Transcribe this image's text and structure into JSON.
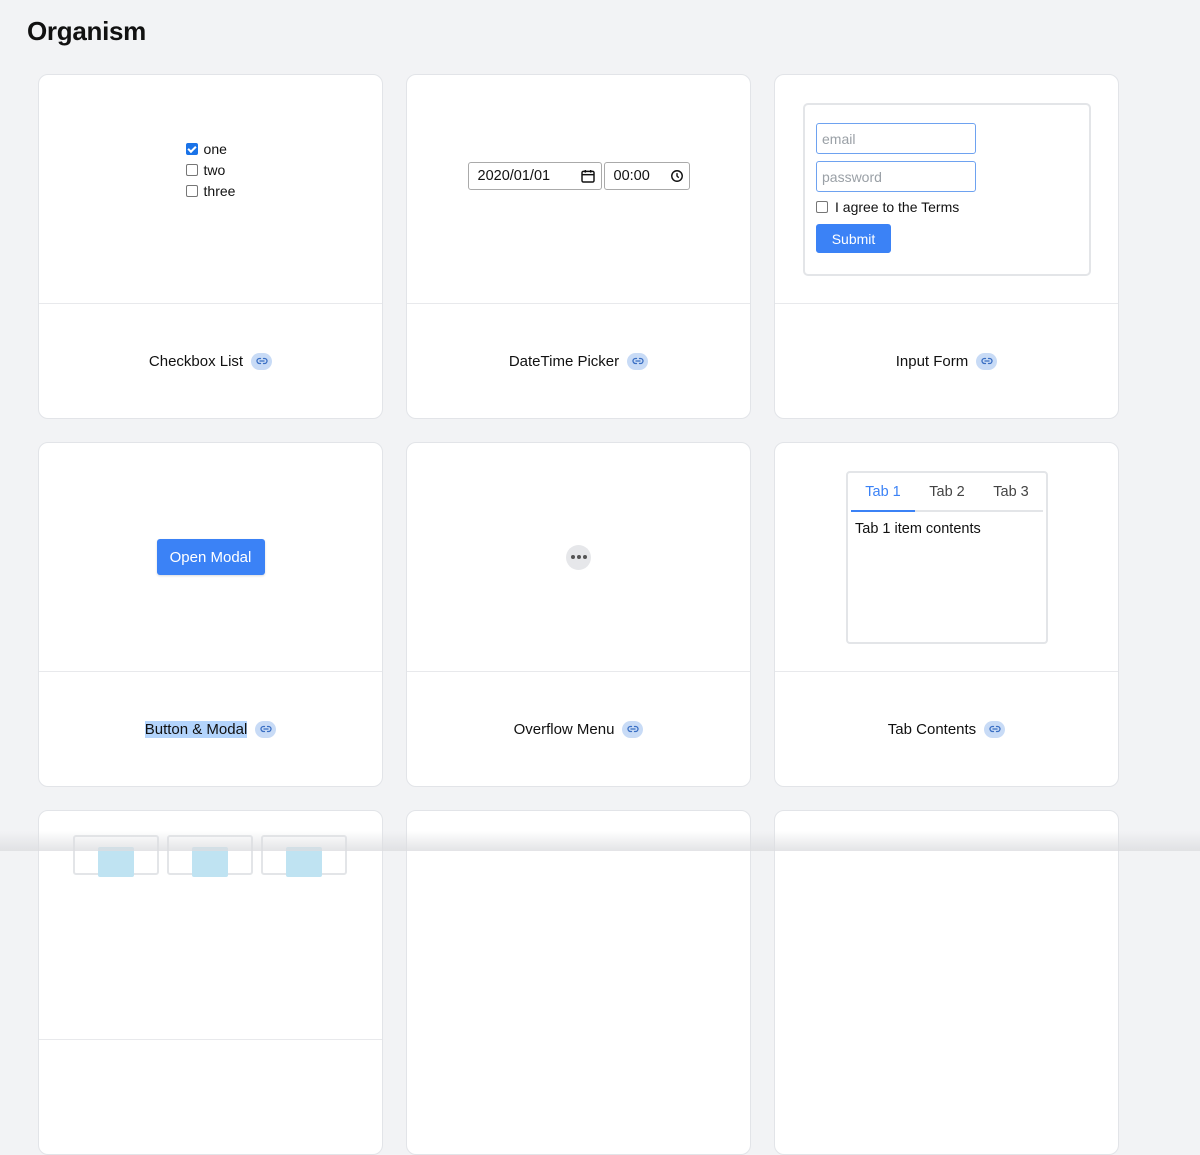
{
  "page": {
    "title": "Organism"
  },
  "cards": {
    "checkbox_list": {
      "label": "Checkbox List",
      "items": [
        {
          "label": "one",
          "checked": true
        },
        {
          "label": "two",
          "checked": false
        },
        {
          "label": "three",
          "checked": false
        }
      ]
    },
    "datetime_picker": {
      "label": "DateTime Picker",
      "date_value": "2020/01/01",
      "time_value": "00:00"
    },
    "input_form": {
      "label": "Input Form",
      "email_placeholder": "email",
      "password_placeholder": "password",
      "terms_label": "I agree to the Terms",
      "submit_label": "Submit"
    },
    "button_modal": {
      "label": "Button & Modal",
      "button_label": "Open Modal"
    },
    "overflow_menu": {
      "label": "Overflow Menu",
      "icon": "more-horizontal-icon"
    },
    "tab_contents": {
      "label": "Tab Contents",
      "tabs": [
        "Tab 1",
        "Tab 2",
        "Tab 3"
      ],
      "active_tab": 0,
      "content": "Tab 1 item contents"
    }
  },
  "colors": {
    "primary": "#3b82f6",
    "background": "#f2f3f5",
    "link_chip": "#c8dbf6"
  },
  "icons": {
    "link": "link-icon",
    "calendar": "calendar-icon",
    "clock": "clock-icon"
  }
}
